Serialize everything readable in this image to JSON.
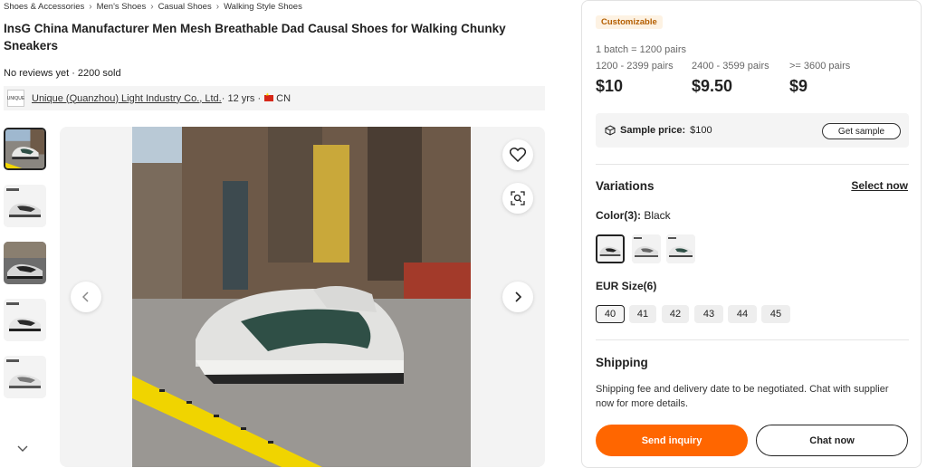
{
  "breadcrumb": [
    "Shoes & Accessories",
    "Men's Shoes",
    "Casual Shoes",
    "Walking Style Shoes"
  ],
  "product": {
    "title": "InsG China Manufacturer Men Mesh Breathable Dad Causal Shoes for Walking Chunky Sneakers",
    "stats": "No reviews yet · 2200 sold"
  },
  "supplier": {
    "logo_text": "UNIQUE",
    "name": "Unique (Quanzhou) Light Industry Co., Ltd.",
    "years": " · 12 yrs · ",
    "country": "CN"
  },
  "pricing": {
    "badge": "Customizable",
    "batch": "1 batch = 1200 pairs",
    "tiers": [
      {
        "range": "1200 - 2399 pairs",
        "price": "$10"
      },
      {
        "range": "2400 - 3599 pairs",
        "price": "$9.50"
      },
      {
        "range": ">= 3600 pairs",
        "price": "$9"
      }
    ]
  },
  "sample": {
    "label": "Sample price:",
    "price": "$100",
    "button": "Get sample"
  },
  "variations": {
    "title": "Variations",
    "select_now": "Select now",
    "color_label": "Color(3):",
    "color_value": " Black",
    "size_label": "EUR Size(6)",
    "sizes": [
      "40",
      "41",
      "42",
      "43",
      "44",
      "45"
    ]
  },
  "shipping": {
    "title": "Shipping",
    "text": "Shipping fee and delivery date to be negotiated. Chat with supplier now for more details."
  },
  "actions": {
    "send_inquiry": "Send inquiry",
    "chat_now": "Chat now"
  },
  "colors": {
    "accent": "#ff6600",
    "badge_bg": "#fdf2e3",
    "badge_text": "#b45e00",
    "shoe_green": "#2f4f46"
  }
}
